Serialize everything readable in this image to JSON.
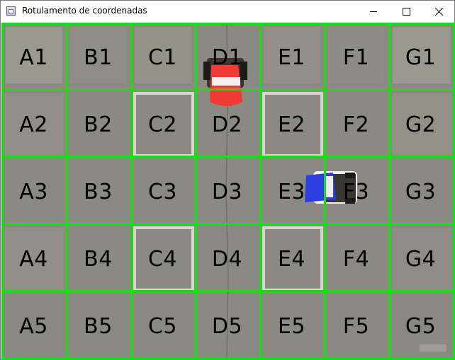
{
  "window": {
    "title": "Rotulamento de coordenadas",
    "icon": "app-window-icon",
    "controls": [
      "minimize-icon",
      "maximize-icon",
      "close-icon"
    ]
  },
  "grid": {
    "line_color": "#12e012",
    "label_color": "#000000",
    "columns": [
      "A",
      "B",
      "C",
      "D",
      "E",
      "F",
      "G"
    ],
    "rows": [
      "1",
      "2",
      "3",
      "4",
      "5"
    ],
    "labels": [
      [
        "A1",
        "B1",
        "C1",
        "D1",
        "E1",
        "F1",
        "G1"
      ],
      [
        "A2",
        "B2",
        "C2",
        "D2",
        "E2",
        "F2",
        "G2"
      ],
      [
        "A3",
        "B3",
        "C3",
        "D3",
        "E3",
        "F3",
        "G3"
      ],
      [
        "A4",
        "B4",
        "C4",
        "D4",
        "E4",
        "F4",
        "G4"
      ],
      [
        "A5",
        "B5",
        "C5",
        "D5",
        "E5",
        "F5",
        "G5"
      ]
    ]
  },
  "scene": {
    "floor_color": "#8b8a82",
    "robots": [
      {
        "name": "red-robot",
        "color": "#f03a36",
        "cell": "D1"
      },
      {
        "name": "blue-robot",
        "color": "#2b3fe0",
        "cell": "E3"
      }
    ]
  }
}
